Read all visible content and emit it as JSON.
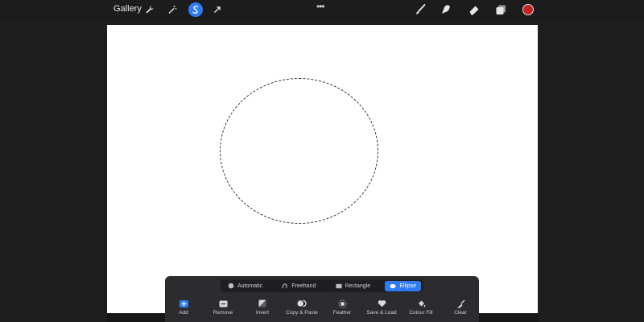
{
  "topbar": {
    "gallery_label": "Gallery",
    "tools": [
      {
        "name": "wrench-icon"
      },
      {
        "name": "magic-wand-icon"
      },
      {
        "name": "selection-icon",
        "selected": true
      },
      {
        "name": "transform-arrow-icon"
      }
    ],
    "more_label": "•••",
    "right_tools": [
      {
        "name": "brush-icon"
      },
      {
        "name": "smudge-icon"
      },
      {
        "name": "eraser-icon"
      },
      {
        "name": "layers-icon"
      },
      {
        "name": "colour-swatch",
        "color": "#c42121"
      }
    ]
  },
  "selection_panel": {
    "modes": [
      {
        "label": "Automatic",
        "icon": "circle-icon",
        "active": false
      },
      {
        "label": "Freehand",
        "icon": "freehand-icon",
        "active": false
      },
      {
        "label": "Rectangle",
        "icon": "rectangle-icon",
        "active": false
      },
      {
        "label": "Ellipse",
        "icon": "ellipse-icon",
        "active": true
      }
    ],
    "actions": [
      {
        "label": "Add",
        "icon": "add-icon"
      },
      {
        "label": "Remove",
        "icon": "remove-icon"
      },
      {
        "label": "Invert",
        "icon": "invert-icon"
      },
      {
        "label": "Copy & Paste",
        "icon": "copy-paste-icon"
      },
      {
        "label": "Feather",
        "icon": "feather-icon"
      },
      {
        "label": "Save & Load",
        "icon": "heart-icon"
      },
      {
        "label": "Colour Fill",
        "icon": "colour-fill-icon"
      },
      {
        "label": "Clear",
        "icon": "clear-icon"
      }
    ]
  },
  "colors": {
    "accent": "#2f7bf6",
    "panel": "#2c2c2e",
    "background": "#1e1e1e",
    "canvas": "#ffffff"
  }
}
